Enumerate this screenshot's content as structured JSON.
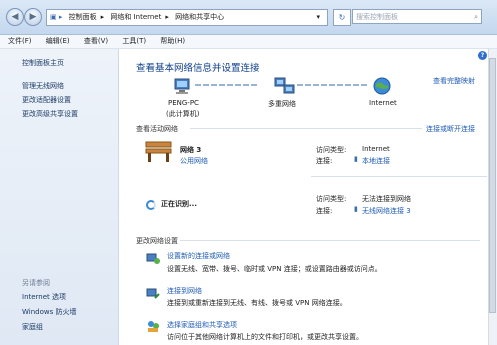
{
  "address": {
    "crumbs": [
      "控制面板",
      "网络和 Internet",
      "网络和共享中心"
    ],
    "search_placeholder": "搜索控制面板"
  },
  "menu": [
    "文件(F)",
    "编辑(E)",
    "查看(V)",
    "工具(T)",
    "帮助(H)"
  ],
  "sidebar": {
    "items": [
      "控制面板主页",
      "管理无线网络",
      "更改适配器设置",
      "更改高级共享设置"
    ],
    "see_also_title": "另请参阅",
    "see_also": [
      "Internet 选项",
      "Windows 防火墙",
      "家庭组"
    ]
  },
  "main": {
    "title": "查看基本网络信息并设置连接",
    "full_map": "查看完整映射",
    "map": {
      "pc_name": "PENG-PC",
      "pc_sub": "(此计算机)",
      "multi_net": "多重网络",
      "internet": "Internet"
    },
    "active_title": "查看活动网络",
    "connect_disconnect": "连接或断开连接",
    "net1": {
      "name": "网络  3",
      "type": "公用网络",
      "access_label": "访问类型:",
      "access_value": "Internet",
      "conn_label": "连接:",
      "conn_value": "本地连接"
    },
    "net2": {
      "status": "正在识别...",
      "access_label": "访问类型:",
      "access_value": "无法连接到网络",
      "conn_label": "连接:",
      "conn_value": "无线网络连接 3"
    },
    "change_title": "更改网络设置",
    "tasks": [
      {
        "title": "设置新的连接或网络",
        "desc": "设置无线、宽带、拨号、临时或 VPN 连接；或设置路由器或访问点。"
      },
      {
        "title": "连接到网络",
        "desc": "连接到或重新连接到无线、有线、拨号或 VPN 网络连接。"
      },
      {
        "title": "选择家庭组和共享选项",
        "desc": "访问位于其他网络计算机上的文件和打印机，或更改共享设置。"
      }
    ]
  },
  "colors": {
    "accent": "#1f5bb5",
    "heading": "#0f3f8a",
    "sidebar": "#e8eff8"
  }
}
